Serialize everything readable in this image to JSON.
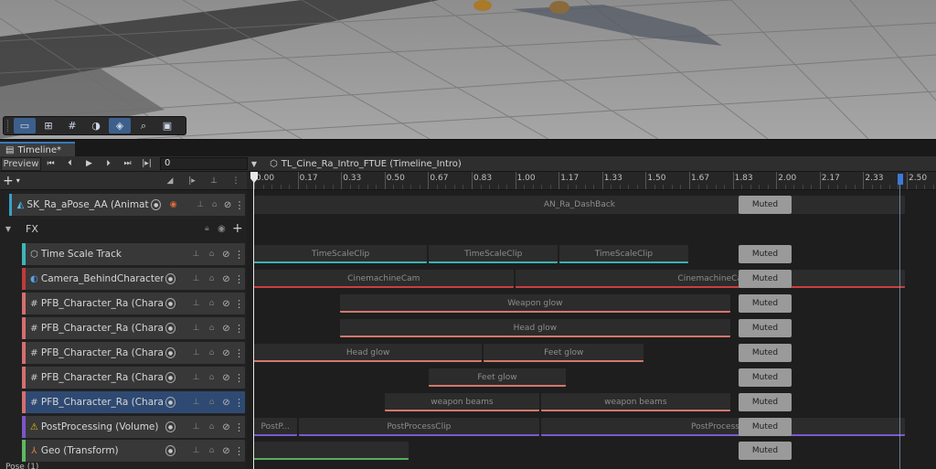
{
  "scene": {
    "toolbar": {
      "items": [
        {
          "icon": "rect-select-icon",
          "active": true
        },
        {
          "icon": "move-tool-icon",
          "active": false
        },
        {
          "icon": "grid-icon",
          "active": false
        },
        {
          "icon": "orbit-icon",
          "active": false
        },
        {
          "icon": "layers-icon",
          "active": true
        },
        {
          "icon": "search-icon",
          "active": false
        },
        {
          "icon": "camera-icon",
          "active": false
        }
      ]
    }
  },
  "timeline": {
    "tab_label": "Timeline*",
    "preview_label": "Preview",
    "frame_value": "0",
    "asset_label": "TL_Cine_Ra_Intro_FTUE (Timeline_Intro)",
    "ruler_labels": [
      "0.00",
      "0.17",
      "0.33",
      "0.50",
      "0.67",
      "0.83",
      "1.00",
      "1.17",
      "1.33",
      "1.50",
      "1.67",
      "1.83",
      "2.00",
      "2.17",
      "2.33",
      "2.50"
    ],
    "fx_group_label": "FX",
    "muted_label": "Muted",
    "status_text": "Pose (1)"
  },
  "tracks": [
    {
      "name": "SK_Ra_aPose_AA (Animator)",
      "color": "#3aa0c8",
      "icon": "animator-icon",
      "record": true,
      "clips": [
        {
          "label": "AN_Ra_DashBack",
          "start": 0.0,
          "end": 2.5,
          "color": "#2b2e33"
        }
      ]
    },
    {
      "name": "Time Scale Track",
      "color": "#3fb6b6",
      "icon": "cube-icon",
      "clips": [
        {
          "label": "TimeScaleClip",
          "start": 0.0,
          "end": 0.67,
          "color": "#38b3b3"
        },
        {
          "label": "TimeScaleClip",
          "start": 0.67,
          "end": 1.17,
          "color": "#38b3b3"
        },
        {
          "label": "TimeScaleClip",
          "start": 1.17,
          "end": 1.67,
          "color": "#38b3b3"
        }
      ]
    },
    {
      "name": "Camera_BehindCharacters (",
      "color": "#c03a3a",
      "icon": "camera-track-icon",
      "clips": [
        {
          "label": "CinemachineCam",
          "start": 0.0,
          "end": 1.0,
          "color": "#c84040"
        },
        {
          "label": "CinemachineCa",
          "start": 1.0,
          "end": 2.5,
          "color": "#c84040"
        }
      ]
    },
    {
      "name": "PFB_Character_Ra (Characte",
      "color": "#d46f6f",
      "icon": "hash-icon",
      "clips": [
        {
          "label": "Weapon glow",
          "start": 0.33,
          "end": 1.83,
          "color": "#d4776b"
        }
      ]
    },
    {
      "name": "PFB_Character_Ra (Characte",
      "color": "#d46f6f",
      "icon": "hash-icon",
      "clips": [
        {
          "label": "Head glow",
          "start": 0.33,
          "end": 1.83,
          "color": "#d4776b"
        }
      ]
    },
    {
      "name": "PFB_Character_Ra (Characte",
      "color": "#d46f6f",
      "icon": "hash-icon",
      "clips": [
        {
          "label": "Head glow",
          "start": 0.0,
          "end": 0.88,
          "color": "#d4776b"
        },
        {
          "label": "Feet glow",
          "start": 0.88,
          "end": 1.5,
          "color": "#d4776b"
        }
      ]
    },
    {
      "name": "PFB_Character_Ra (Characte",
      "color": "#d46f6f",
      "icon": "hash-icon",
      "clips": [
        {
          "label": "Feet glow",
          "start": 0.67,
          "end": 1.2,
          "color": "#d4776b"
        }
      ]
    },
    {
      "name": "PFB_Character_Ra (Characte",
      "color": "#d46f6f",
      "icon": "hash-icon",
      "selected": true,
      "clips": [
        {
          "label": "weapon beams",
          "start": 0.5,
          "end": 1.1,
          "color": "#d4776b"
        },
        {
          "label": "weapon beams",
          "start": 1.1,
          "end": 1.83,
          "color": "#d4776b"
        }
      ]
    },
    {
      "name": "PostProcessing (Volume)",
      "color": "#7b56c8",
      "icon": "warning-icon",
      "clips": [
        {
          "label": "PostP...",
          "start": 0.0,
          "end": 0.17,
          "color": "#7d5ad0"
        },
        {
          "label": "PostProcessClip",
          "start": 0.17,
          "end": 1.1,
          "color": "#7d5ad0"
        },
        {
          "label": "PostProcessClip",
          "start": 1.1,
          "end": 2.5,
          "color": "#7d5ad0"
        }
      ]
    },
    {
      "name": "Geo (Transform)",
      "color": "#5fb85f",
      "icon": "transform-icon",
      "clips": [
        {
          "label": "",
          "start": 0.0,
          "end": 0.6,
          "color": "#57b057"
        }
      ]
    }
  ]
}
